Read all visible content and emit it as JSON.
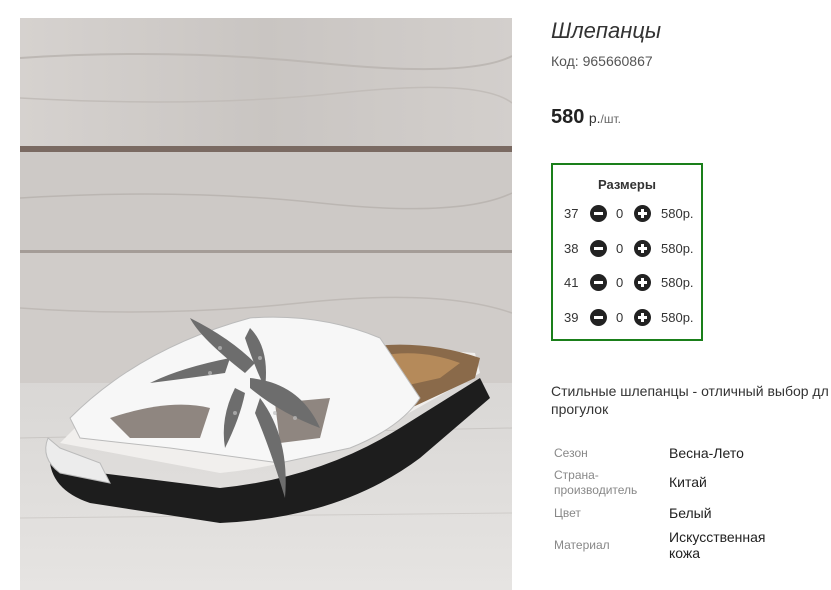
{
  "product": {
    "title": "Шлепанцы",
    "code_text": "Код: 965660867",
    "price": {
      "value": "580",
      "unit": "р.",
      "per": "/шт."
    }
  },
  "sizes": {
    "header": "Размеры",
    "rows": [
      {
        "size": "37",
        "qty": "0",
        "price": "580р."
      },
      {
        "size": "38",
        "qty": "0",
        "price": "580р."
      },
      {
        "size": "41",
        "qty": "0",
        "price": "580р."
      },
      {
        "size": "39",
        "qty": "0",
        "price": "580р."
      }
    ],
    "border_color": "#1a7f1a"
  },
  "description": {
    "line1": "Стильные шлепанцы - отличный выбор дл",
    "line2": "прогулок"
  },
  "properties": [
    {
      "key": "Сезон",
      "value": "Весна-Лето"
    },
    {
      "key_line1": "Страна-",
      "key_line2": "производитель",
      "value": "Китай"
    },
    {
      "key": "Цвет",
      "value": "Белый"
    },
    {
      "key": "Материал",
      "value_line1": "Искусственная",
      "value_line2": "кожа"
    }
  ],
  "icons": {
    "minus": "minus-circle-icon",
    "plus": "plus-circle-icon"
  }
}
